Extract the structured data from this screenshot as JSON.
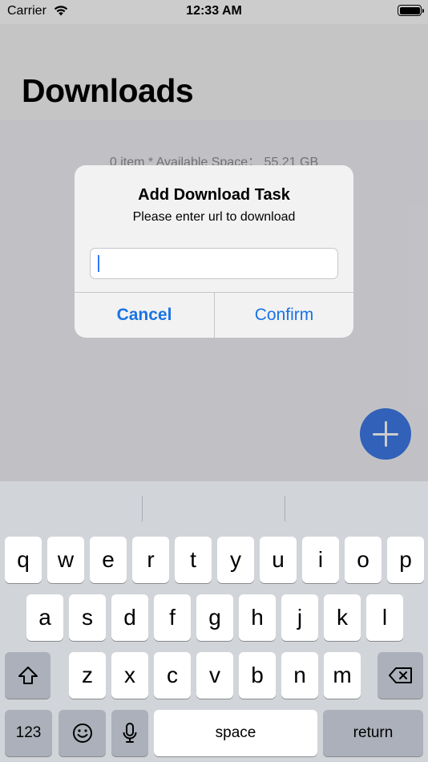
{
  "status_bar": {
    "carrier": "Carrier",
    "time": "12:33 AM"
  },
  "nav": {
    "title": "Downloads"
  },
  "content": {
    "storage_info": "0 item * Available Space： 55.21 GB"
  },
  "fab": {
    "icon": "plus-icon",
    "color": "#3e7ae6"
  },
  "alert": {
    "title": "Add Download Task",
    "message": "Please enter url to download",
    "input_value": "",
    "cancel_label": "Cancel",
    "confirm_label": "Confirm",
    "button_color": "#1a73e3"
  },
  "keyboard": {
    "row1": [
      "q",
      "w",
      "e",
      "r",
      "t",
      "y",
      "u",
      "i",
      "o",
      "p"
    ],
    "row2": [
      "a",
      "s",
      "d",
      "f",
      "g",
      "h",
      "j",
      "k",
      "l"
    ],
    "row3": [
      "z",
      "x",
      "c",
      "v",
      "b",
      "n",
      "m"
    ],
    "numbers_label": "123",
    "space_label": "space",
    "return_label": "return",
    "shift_icon": "shift-icon",
    "delete_icon": "delete-backspace-icon",
    "emoji_icon": "emoji-icon",
    "mic_icon": "microphone-icon"
  }
}
